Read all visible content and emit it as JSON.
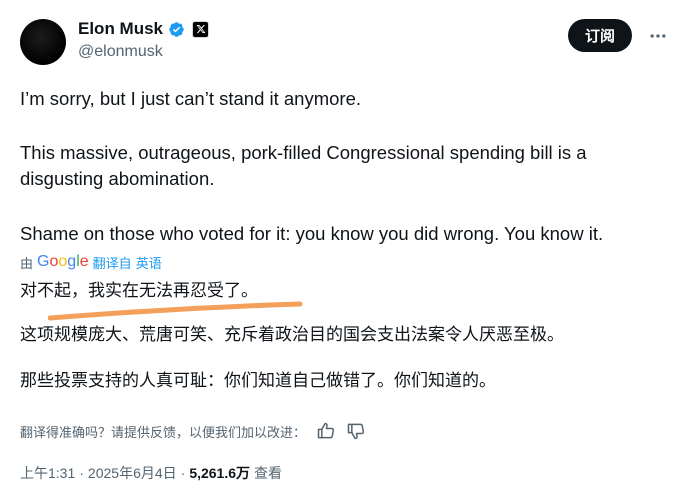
{
  "author": {
    "display_name": "Elon Musk",
    "handle": "@elonmusk",
    "verified": true
  },
  "header": {
    "subscribe_label": "订阅"
  },
  "tweet": {
    "paragraphs": [
      "I’m sorry, but I just can’t stand it anymore.",
      "This massive, outrageous, pork-filled Congressional spending bill is a disgusting abomination.",
      "Shame on those who voted for it: you know you did wrong. You know it."
    ]
  },
  "translation": {
    "by_label": "由",
    "provider": "Google",
    "link_label": "翻译自 英语",
    "paragraphs": [
      "对不起，我实在无法再忍受了。",
      "这项规模庞大、荒唐可笑、充斥着政治目的国会支出法案令人厌恶至极。",
      "那些投票支持的人真可耻：你们知道自己做错了。你们知道的。"
    ],
    "feedback_prompt": "翻译得准确吗？请提供反馈，以便我们加以改进："
  },
  "meta": {
    "time": "上午1:31",
    "separator": "·",
    "date": "2025年6月4日",
    "views": "5,261.6万",
    "views_label": "查看"
  },
  "colors": {
    "accent": "#1d9bf0",
    "underline": "#f5a05a",
    "button_bg": "#0f1419"
  }
}
